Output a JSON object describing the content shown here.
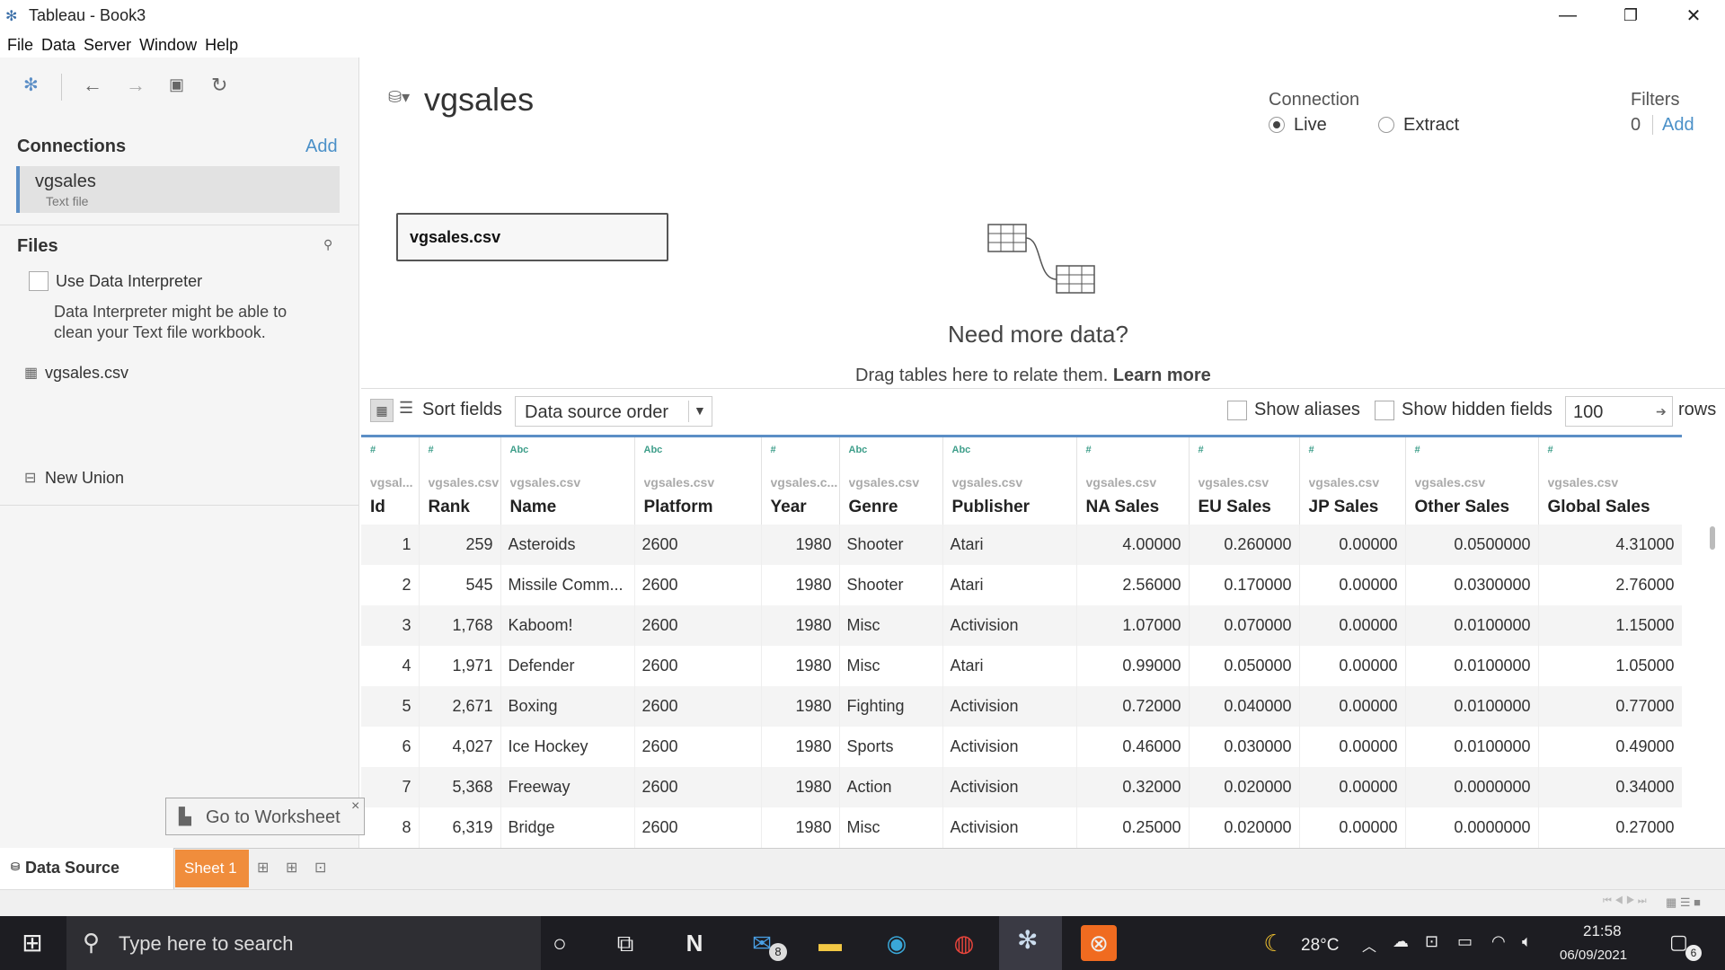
{
  "window": {
    "title": "Tableau - Book3",
    "minimize": "—",
    "restore": "❐",
    "close": "✕"
  },
  "menu": [
    "File",
    "Data",
    "Server",
    "Window",
    "Help"
  ],
  "left": {
    "connections_heading": "Connections",
    "add_label": "Add",
    "connection": {
      "name": "vgsales",
      "type": "Text file"
    },
    "files_heading": "Files",
    "interpreter_label": "Use Data Interpreter",
    "interpreter_note_line1": "Data Interpreter might be able to",
    "interpreter_note_line2": "clean your Text file workbook.",
    "file_item": "vgsales.csv",
    "new_union": "New Union"
  },
  "main": {
    "datasource_title": "vgsales",
    "connection_label": "Connection",
    "live_label": "Live",
    "extract_label": "Extract",
    "connection_selected": "Live",
    "filters_label": "Filters",
    "filters_count": "0",
    "filters_add": "Add",
    "table_box": "vgsales.csv",
    "need_more": "Need more data?",
    "drag_text": "Drag tables here to relate them.",
    "learn_more": "Learn more"
  },
  "grid_toolbar": {
    "sort_label": "Sort fields",
    "sort_value": "Data source order",
    "show_aliases": "Show aliases",
    "show_hidden": "Show hidden fields",
    "rows_value": "100",
    "rows_label": "rows"
  },
  "columns": [
    {
      "type": "#",
      "source": "vgsal...",
      "name": "Id",
      "align": "r"
    },
    {
      "type": "#",
      "source": "vgsales.csv",
      "name": "Rank",
      "align": "r"
    },
    {
      "type": "Abc",
      "source": "vgsales.csv",
      "name": "Name",
      "align": "l"
    },
    {
      "type": "Abc",
      "source": "vgsales.csv",
      "name": "Platform",
      "align": "l"
    },
    {
      "type": "#",
      "source": "vgsales.c...",
      "name": "Year",
      "align": "r"
    },
    {
      "type": "Abc",
      "source": "vgsales.csv",
      "name": "Genre",
      "align": "l"
    },
    {
      "type": "Abc",
      "source": "vgsales.csv",
      "name": "Publisher",
      "align": "l"
    },
    {
      "type": "#",
      "source": "vgsales.csv",
      "name": "NA Sales",
      "align": "r"
    },
    {
      "type": "#",
      "source": "vgsales.csv",
      "name": "EU Sales",
      "align": "r"
    },
    {
      "type": "#",
      "source": "vgsales.csv",
      "name": "JP Sales",
      "align": "r"
    },
    {
      "type": "#",
      "source": "vgsales.csv",
      "name": "Other Sales",
      "align": "r"
    },
    {
      "type": "#",
      "source": "vgsales.csv",
      "name": "Global Sales",
      "align": "r"
    }
  ],
  "rows": [
    [
      "1",
      "259",
      "Asteroids",
      "2600",
      "1980",
      "Shooter",
      "Atari",
      "4.00000",
      "0.260000",
      "0.00000",
      "0.0500000",
      "4.31000"
    ],
    [
      "2",
      "545",
      "Missile Comm...",
      "2600",
      "1980",
      "Shooter",
      "Atari",
      "2.56000",
      "0.170000",
      "0.00000",
      "0.0300000",
      "2.76000"
    ],
    [
      "3",
      "1,768",
      "Kaboom!",
      "2600",
      "1980",
      "Misc",
      "Activision",
      "1.07000",
      "0.070000",
      "0.00000",
      "0.0100000",
      "1.15000"
    ],
    [
      "4",
      "1,971",
      "Defender",
      "2600",
      "1980",
      "Misc",
      "Atari",
      "0.99000",
      "0.050000",
      "0.00000",
      "0.0100000",
      "1.05000"
    ],
    [
      "5",
      "2,671",
      "Boxing",
      "2600",
      "1980",
      "Fighting",
      "Activision",
      "0.72000",
      "0.040000",
      "0.00000",
      "0.0100000",
      "0.77000"
    ],
    [
      "6",
      "4,027",
      "Ice Hockey",
      "2600",
      "1980",
      "Sports",
      "Activision",
      "0.46000",
      "0.030000",
      "0.00000",
      "0.0100000",
      "0.49000"
    ],
    [
      "7",
      "5,368",
      "Freeway",
      "2600",
      "1980",
      "Action",
      "Activision",
      "0.32000",
      "0.020000",
      "0.00000",
      "0.0000000",
      "0.34000"
    ],
    [
      "8",
      "6,319",
      "Bridge",
      "2600",
      "1980",
      "Misc",
      "Activision",
      "0.25000",
      "0.020000",
      "0.00000",
      "0.0000000",
      "0.27000"
    ]
  ],
  "bottom": {
    "data_source_tab": "Data Source",
    "sheet_tab": "Sheet 1",
    "tooltip": "Go to Worksheet",
    "tooltip_close": "×"
  },
  "taskbar": {
    "search_placeholder": "Type here to search",
    "mail_badge": "8",
    "weather": "28°C",
    "time": "21:58",
    "date": "06/09/2021",
    "notif_count": "6"
  },
  "colors": {
    "accent": "#5b8ec6",
    "sheet_tab": "#f08d3c",
    "taskbar": "#1d1d22"
  }
}
